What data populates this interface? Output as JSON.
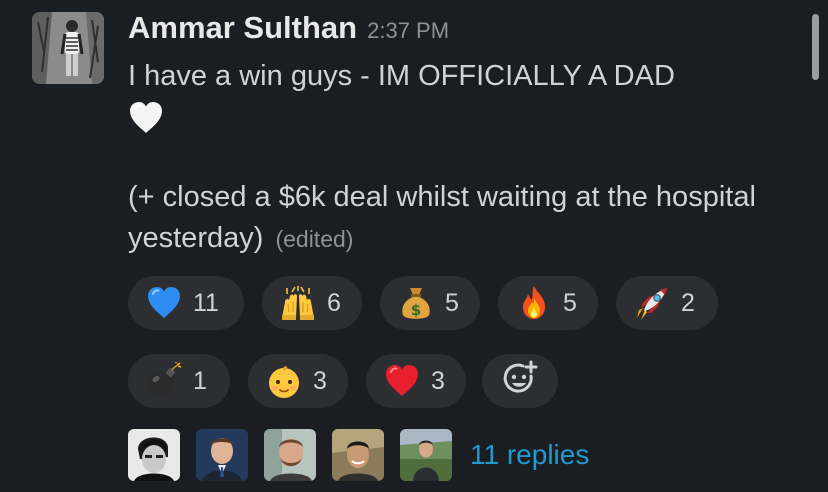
{
  "message": {
    "author": "Ammar Sulthan",
    "timestamp": "2:37 PM",
    "line1": "I have a win guys - IM OFFICIALLY A DAD",
    "line2": "(+ closed a $6k deal whilst waiting at the hospital yesterday)",
    "edited_label": "(edited)",
    "heart_icon": "white-heart"
  },
  "reactions": [
    {
      "emoji": "blue-heart",
      "count": "11"
    },
    {
      "emoji": "raising-hands",
      "count": "6"
    },
    {
      "emoji": "money-bag",
      "count": "5"
    },
    {
      "emoji": "fire",
      "count": "5"
    },
    {
      "emoji": "rocket",
      "count": "2"
    },
    {
      "emoji": "bomb",
      "count": "1"
    },
    {
      "emoji": "baby",
      "count": "3"
    },
    {
      "emoji": "red-heart",
      "count": "3"
    }
  ],
  "add_reaction_icon": "add-emoji",
  "thread": {
    "replies_label": "11 replies",
    "participant_count": 5
  },
  "colors": {
    "background": "#1a1d21",
    "pill": "#2c2e32",
    "link": "#1d9bd1",
    "text": "#d1d2d3",
    "muted": "#8f9194"
  }
}
